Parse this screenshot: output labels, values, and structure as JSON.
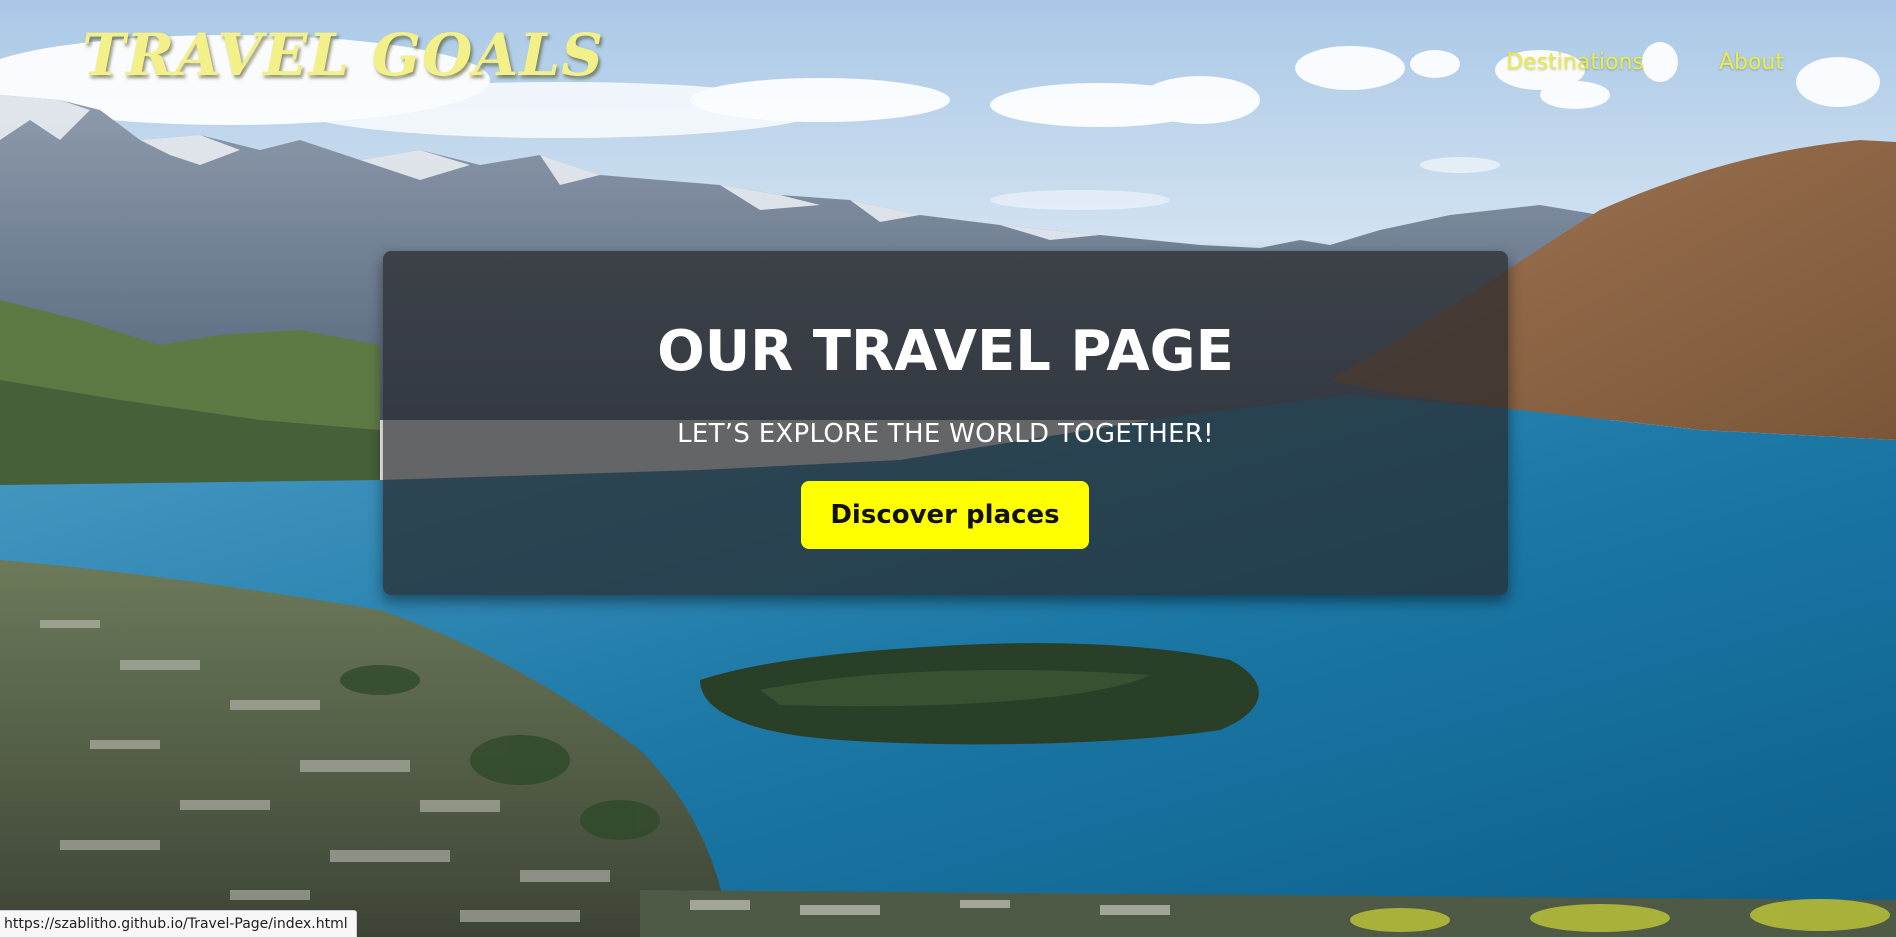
{
  "header": {
    "logo_text": "TRAVEL GOALS",
    "nav": [
      {
        "label": "Destinations"
      },
      {
        "label": "About"
      }
    ]
  },
  "hero": {
    "title": "OUR TRAVEL PAGE",
    "subtitle": "LET’S EXPLORE THE WORLD TOGETHER!",
    "cta_label": "Discover places"
  },
  "status_bar": {
    "url": "https://szablitho.github.io/Travel-Page/index.html"
  },
  "colors": {
    "logo": "#f3f08a",
    "nav_link": "#ecec3c",
    "cta_background": "#ffff00",
    "hero_overlay": "#282a2c",
    "lake": "#1c78a6"
  },
  "background": {
    "subject": "aerial view of a mountain lake town with a wooded peninsula"
  }
}
